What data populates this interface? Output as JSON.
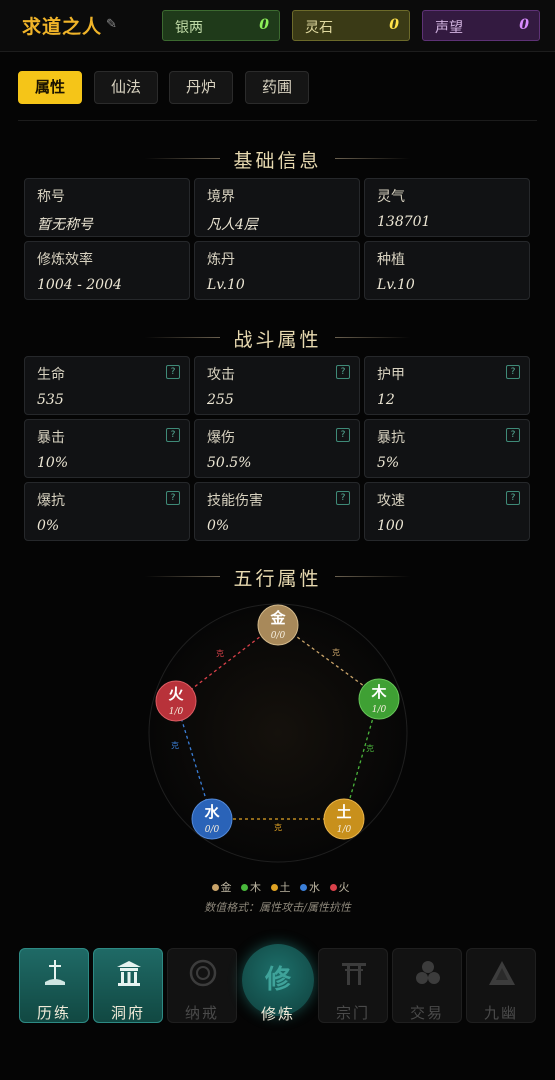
{
  "header": {
    "title": "求道之人",
    "currencies": [
      {
        "label": "银两",
        "value": "0"
      },
      {
        "label": "灵石",
        "value": "0"
      },
      {
        "label": "声望",
        "value": "0"
      }
    ]
  },
  "tabs": [
    {
      "label": "属性"
    },
    {
      "label": "仙法"
    },
    {
      "label": "丹炉"
    },
    {
      "label": "药圃"
    }
  ],
  "basic": {
    "title": "基础信息",
    "cells": [
      {
        "label": "称号",
        "value": "暂无称号"
      },
      {
        "label": "境界",
        "value": "凡人4层"
      },
      {
        "label": "灵气",
        "value": "138701"
      },
      {
        "label": "修炼效率",
        "value": "1004 - 2004"
      },
      {
        "label": "炼丹",
        "value": "Lv.10"
      },
      {
        "label": "种植",
        "value": "Lv.10"
      }
    ]
  },
  "combat": {
    "title": "战斗属性",
    "cells": [
      {
        "label": "生命",
        "value": "535"
      },
      {
        "label": "攻击",
        "value": "255"
      },
      {
        "label": "护甲",
        "value": "12"
      },
      {
        "label": "暴击",
        "value": "10%"
      },
      {
        "label": "爆伤",
        "value": "50.5%"
      },
      {
        "label": "暴抗",
        "value": "5%"
      },
      {
        "label": "爆抗",
        "value": "0%"
      },
      {
        "label": "技能伤害",
        "value": "0%"
      },
      {
        "label": "攻速",
        "value": "100"
      }
    ]
  },
  "elements": {
    "title": "五行属性",
    "nodes": [
      {
        "char": "金",
        "value": "0/0",
        "color": "#a8895a"
      },
      {
        "char": "木",
        "value": "1/0",
        "color": "#3fa034"
      },
      {
        "char": "土",
        "value": "1/0",
        "color": "#c8901c"
      },
      {
        "char": "水",
        "value": "0/0",
        "color": "#2a63b8"
      },
      {
        "char": "火",
        "value": "1/0",
        "color": "#b8323a"
      }
    ],
    "restrain_label": "克",
    "legend": [
      {
        "label": "金",
        "color": "#c9a46a"
      },
      {
        "label": "木",
        "color": "#49b83c"
      },
      {
        "label": "土",
        "color": "#e0a324"
      },
      {
        "label": "水",
        "color": "#3b7fd8"
      },
      {
        "label": "火",
        "color": "#d9414a"
      }
    ],
    "format_note": "数值格式：属性攻击/属性抗性"
  },
  "nav": [
    {
      "label": "历练",
      "state": "on"
    },
    {
      "label": "洞府",
      "state": "on"
    },
    {
      "label": "纳戒",
      "state": "off"
    },
    {
      "label": "修炼",
      "state": "center",
      "glyph": "修"
    },
    {
      "label": "宗门",
      "state": "off"
    },
    {
      "label": "交易",
      "state": "off"
    },
    {
      "label": "九幽",
      "state": "off"
    }
  ]
}
